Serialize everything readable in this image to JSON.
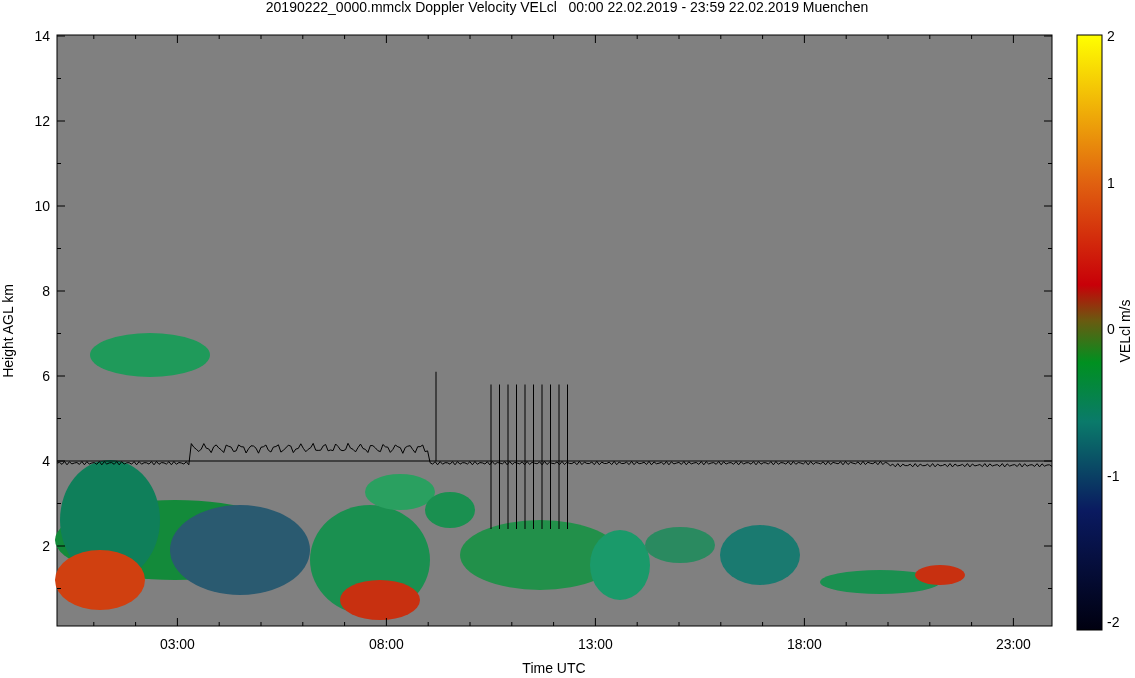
{
  "title": "20190222_0000.mmclx Doppler Velocity VELcl   00:00 22.02.2019 - 23:59 22.02.2019 Muenchen",
  "y_axis": {
    "label": "Height AGL km",
    "ticks": [
      "14",
      "12",
      "10",
      "8",
      "6",
      "4",
      "2"
    ]
  },
  "x_axis": {
    "label": "Time UTC",
    "ticks": [
      "03:00",
      "08:00",
      "13:00",
      "18:00",
      "23:00"
    ]
  },
  "colorbar": {
    "label": "VELcl m/s",
    "ticks": [
      "2",
      "1",
      "0",
      "-1",
      "-2"
    ]
  }
}
